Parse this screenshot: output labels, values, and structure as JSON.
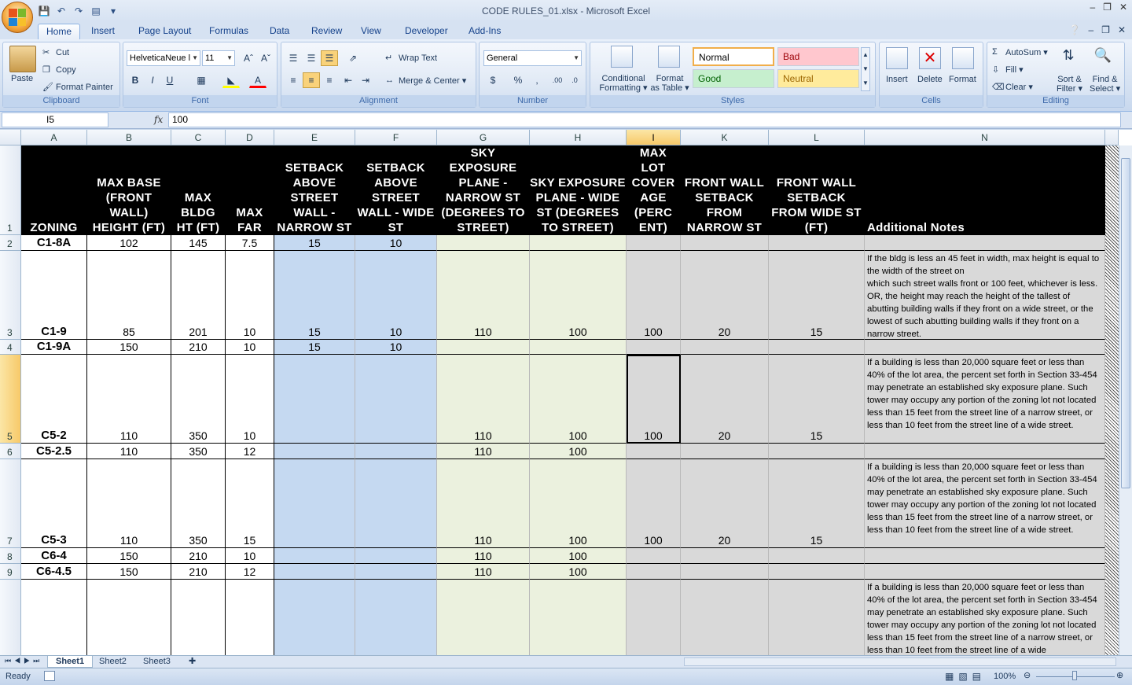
{
  "window": {
    "title": "CODE RULES_01.xlsx - Microsoft Excel"
  },
  "ribbon_tabs": [
    "Home",
    "Insert",
    "Page Layout",
    "Formulas",
    "Data",
    "Review",
    "View",
    "Developer",
    "Add-Ins"
  ],
  "active_tab": "Home",
  "clipboard": {
    "paste": "Paste",
    "cut": "Cut",
    "copy": "Copy",
    "format_painter": "Format Painter",
    "label": "Clipboard"
  },
  "font": {
    "name": "HelveticaNeue l",
    "size": "11",
    "label": "Font",
    "bold": "B",
    "italic": "I",
    "underline": "U"
  },
  "alignment": {
    "wrap_text": "Wrap Text",
    "merge_center": "Merge & Center",
    "label": "Alignment"
  },
  "number": {
    "format": "General",
    "label": "Number",
    "currency": "$",
    "percent": "%",
    "comma": ","
  },
  "styles": {
    "conditional": "Conditional",
    "conditional2": "Formatting",
    "format_as": "Format",
    "format_as2": "as Table",
    "normal": "Normal",
    "bad": "Bad",
    "good": "Good",
    "neutral": "Neutral",
    "label": "Styles"
  },
  "cells": {
    "insert": "Insert",
    "delete": "Delete",
    "format": "Format",
    "label": "Cells"
  },
  "editing": {
    "autosum": "AutoSum",
    "fill": "Fill",
    "clear": "Clear",
    "sort": "Sort &",
    "sort2": "Filter",
    "find": "Find &",
    "find2": "Select",
    "label": "Editing"
  },
  "formula_bar": {
    "name_box": "I5",
    "fx": "fx",
    "content": "100"
  },
  "columns": [
    "A",
    "B",
    "C",
    "D",
    "E",
    "F",
    "G",
    "H",
    "I",
    "K",
    "L",
    "N"
  ],
  "selected_column": "I",
  "headers": [
    "ZONING",
    "MAX BASE (FRONT WALL) HEIGHT (FT)",
    "MAX BLDG HT (FT)",
    "MAX FAR",
    "SETBACK ABOVE STREET WALL - NARROW ST",
    "SETBACK ABOVE STREET WALL - WIDE ST",
    "SKY EXPOSURE PLANE - NARROW ST (DEGREES TO STREET)",
    "SKY EXPOSURE PLANE - WIDE ST (DEGREES TO STREET)",
    "MAX LOT COVER AGE (PERC ENT)",
    "FRONT WALL SETBACK FROM NARROW ST",
    "FRONT WALL SETBACK FROM WIDE ST (FT)",
    "Additional Notes"
  ],
  "rows": [
    {
      "num": "2",
      "cells": [
        "C1-8A",
        "102",
        "145",
        "7.5",
        "15",
        "10",
        "",
        "",
        "",
        "",
        "",
        ""
      ]
    },
    {
      "num": "3",
      "cells": [
        "C1-9",
        "85",
        "201",
        "10",
        "15",
        "10",
        "110",
        "100",
        "100",
        "20",
        "15",
        "If the bldg is less an 45 feet in width, max height is equal to the width of the street on\nwhich such street walls front or 100 feet, whichever is less. OR, the height may reach the height of the tallest of abutting building walls if they front on a wide street, or the lowest of such abutting building walls if they front on a narrow street."
      ]
    },
    {
      "num": "4",
      "cells": [
        "C1-9A",
        "150",
        "210",
        "10",
        "15",
        "10",
        "",
        "",
        "",
        "",
        "",
        ""
      ]
    },
    {
      "num": "5",
      "cells": [
        "C5-2",
        "110",
        "350",
        "10",
        "",
        "",
        "110",
        "100",
        "100",
        "20",
        "15",
        "If a building is less than 20,000 square feet or less than 40% of the lot area, the percent set forth in Section 33-454 may penetrate an established sky exposure plane. Such tower may occupy any portion of the zoning lot not located less than 15 feet from the street line of a narrow street, or less than 10 feet from the street line of a wide street."
      ]
    },
    {
      "num": "6",
      "cells": [
        "C5-2.5",
        "110",
        "350",
        "12",
        "",
        "",
        "110",
        "100",
        "",
        "",
        "",
        ""
      ]
    },
    {
      "num": "7",
      "cells": [
        "C5-3",
        "110",
        "350",
        "15",
        "",
        "",
        "110",
        "100",
        "100",
        "20",
        "15",
        "If a building is less than 20,000 square feet or less than 40% of the lot area, the percent set forth in Section 33-454 may penetrate an established sky exposure plane. Such tower may occupy any portion of the zoning lot not located less than 15 feet from the street line of a narrow street, or less than 10 feet from the street line of a wide street."
      ]
    },
    {
      "num": "8",
      "cells": [
        "C6-4",
        "150",
        "210",
        "10",
        "",
        "",
        "110",
        "100",
        "",
        "",
        "",
        ""
      ]
    },
    {
      "num": "9",
      "cells": [
        "C6-4.5",
        "150",
        "210",
        "12",
        "",
        "",
        "110",
        "100",
        "",
        "",
        "",
        ""
      ]
    },
    {
      "num": "",
      "cells": [
        "",
        "",
        "",
        "",
        "",
        "",
        "",
        "",
        "",
        "",
        "",
        "If a building is less than 20,000 square feet or less than 40% of the lot area, the percent set forth in Section 33-454 may penetrate an established sky exposure plane. Such tower may occupy any portion of the zoning lot not located less than 15 feet from the street line of a narrow street, or less than 10 feet from the street line of a wide"
      ]
    }
  ],
  "sheets": [
    "Sheet1",
    "Sheet2",
    "Sheet3"
  ],
  "active_sheet": "Sheet1",
  "status": {
    "ready": "Ready",
    "zoom": "100%"
  },
  "colors": {
    "blue_fill": "#c5d9f1",
    "green_fill": "#ebf1de",
    "gray_fill": "#d9d9d9",
    "header_fill": "#000000"
  }
}
